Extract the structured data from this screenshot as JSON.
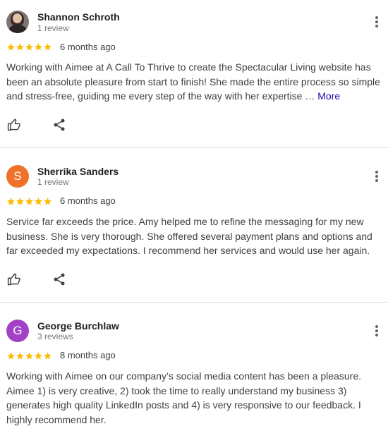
{
  "colors": {
    "star": "#fbbc04",
    "more_link": "#1a0dab",
    "avatar_orange": "#f0722a",
    "avatar_purple": "#a142c7"
  },
  "reviews": [
    {
      "author": "Shannon Schroth",
      "review_count": "1 review",
      "rating": 5,
      "time": "6 months ago",
      "text": "Working with Aimee at A Call To Thrive to create the Spectacular Living website has been an absolute pleasure from start to finish! She made the entire process so simple and stress-free, guiding me every step of the way with her expertise …",
      "more_label": "More",
      "avatar": {
        "type": "photo"
      }
    },
    {
      "author": "Sherrika Sanders",
      "review_count": "1 review",
      "rating": 5,
      "time": "6 months ago",
      "text": "Service far exceeds the price. Amy helped me to refine the messaging for my new business. She is very thorough. She offered several payment plans and options and far exceeded my expectations. I recommend her services and would use her again.",
      "avatar": {
        "type": "letter",
        "letter": "S"
      }
    },
    {
      "author": "George Burchlaw",
      "review_count": "3 reviews",
      "rating": 5,
      "time": "8 months ago",
      "text": "Working with Aimee on our company’s social media content has been a pleasure. Aimee 1) is very creative, 2) took the time to really understand my business 3) generates high quality LinkedIn posts and 4) is very responsive to our feedback. I highly recommend her.",
      "avatar": {
        "type": "letter",
        "letter": "G"
      }
    }
  ]
}
